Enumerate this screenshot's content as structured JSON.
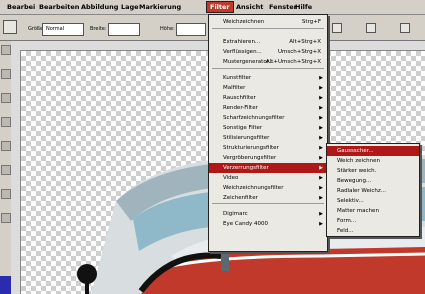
{
  "menubar": {
    "items": [
      "Bearbei",
      "Bearbeiten",
      "Abbildung",
      "Lage",
      "Markierung",
      "Filter",
      "Ansicht",
      "Fenster",
      "Hilfe"
    ]
  },
  "options_bar": {
    "size_label": "Größe:",
    "size_value": "Normal",
    "width_label": "Breite:",
    "height_label": "Höhe:"
  },
  "filter_menu": {
    "items": [
      {
        "label": "Weichzeichnen",
        "shortcut": "Strg+F",
        "arrow": false
      },
      {
        "label": "Extrahieren...",
        "shortcut": "Alt+Strg+X",
        "arrow": false
      },
      {
        "label": "Verflüssigen...",
        "shortcut": "Umsch+Strg+X",
        "arrow": false
      },
      {
        "label": "Mustergenerator...",
        "shortcut": "Alt+Umsch+Strg+X",
        "arrow": false
      },
      {
        "label": "Kunstfilter",
        "shortcut": "",
        "arrow": true
      },
      {
        "label": "Malfilter",
        "shortcut": "",
        "arrow": true
      },
      {
        "label": "Rauschfilter",
        "shortcut": "",
        "arrow": true
      },
      {
        "label": "Render-Filter",
        "shortcut": "",
        "arrow": true
      },
      {
        "label": "Scharfzeichnungsfilter",
        "shortcut": "",
        "arrow": true
      },
      {
        "label": "Sonstige Filter",
        "shortcut": "",
        "arrow": true
      },
      {
        "label": "Stilisierungsfilter",
        "shortcut": "",
        "arrow": true
      },
      {
        "label": "Strukturierungsfilter",
        "shortcut": "",
        "arrow": true
      },
      {
        "label": "Vergröberungsfilter",
        "shortcut": "",
        "arrow": true
      },
      {
        "label": "Verzerrungsfilter",
        "shortcut": "",
        "arrow": true
      },
      {
        "label": "Video",
        "shortcut": "",
        "arrow": true
      },
      {
        "label": "Weichzeichnungsfilter",
        "shortcut": "",
        "arrow": true
      },
      {
        "label": "Zeichenfilter",
        "shortcut": "",
        "arrow": true
      },
      {
        "label": "Digimarc",
        "shortcut": "",
        "arrow": true
      },
      {
        "label": "Eye Candy 4000",
        "shortcut": "",
        "arrow": true
      }
    ]
  },
  "submenu": {
    "items": [
      "Gaussscher...",
      "Weich zeichnen",
      "Stärker weich.",
      "Bewegung...",
      "Radialer Weichz...",
      "Selektiv...",
      "Matter machen",
      "Form...",
      "Feld..."
    ]
  },
  "colors": {
    "accent": "#b01818",
    "truck_body": "#c0392b",
    "truck_window": "#8fb8c8"
  },
  "icons": [
    "move-tool-icon",
    "lasso-tool-icon",
    "crop-tool-icon",
    "brush-tool-icon",
    "eraser-tool-icon",
    "text-tool-icon",
    "hand-tool-icon",
    "zoom-tool-icon"
  ]
}
